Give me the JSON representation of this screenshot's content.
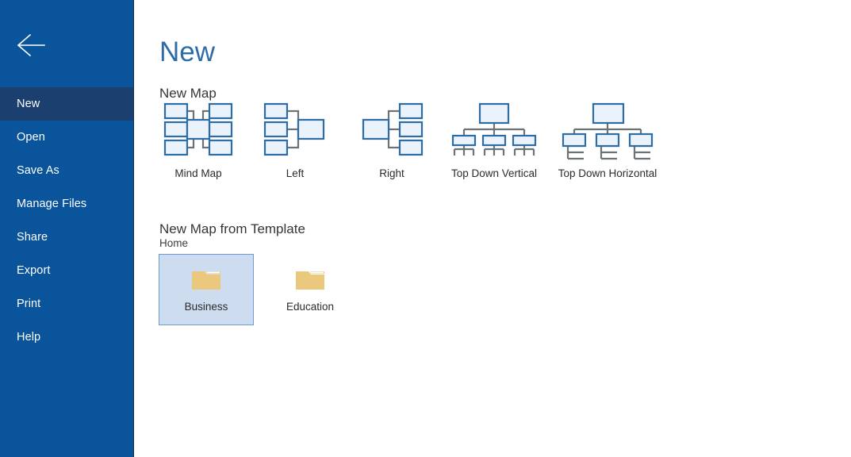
{
  "window": {
    "title": "New"
  },
  "sidebar": {
    "back_icon": "back-arrow-icon",
    "background_color": "#0a549b",
    "active_color": "#1b3f6e",
    "items": [
      {
        "label": "New",
        "active": true
      },
      {
        "label": "Open",
        "active": false
      },
      {
        "label": "Save As",
        "active": false
      },
      {
        "label": "Manage Files",
        "active": false
      },
      {
        "label": "Share",
        "active": false
      },
      {
        "label": "Export",
        "active": false
      },
      {
        "label": "Print",
        "active": false
      },
      {
        "label": "Help",
        "active": false
      }
    ]
  },
  "main": {
    "page_title": "New",
    "title_color": "#2e6ca8",
    "new_map": {
      "heading": "New Map",
      "node_fill": "#eaf3fb",
      "node_stroke": "#2e6da4",
      "connector_color": "#6b7377",
      "items": [
        {
          "label": "Mind Map",
          "icon": "mind-map-icon"
        },
        {
          "label": "Left",
          "icon": "left-layout-icon"
        },
        {
          "label": "Right",
          "icon": "right-layout-icon"
        },
        {
          "label": "Top Down Vertical",
          "icon": "top-down-vertical-icon"
        },
        {
          "label": "Top Down Horizontal",
          "icon": "top-down-horizontal-icon"
        }
      ]
    },
    "template": {
      "heading": "New Map from Template",
      "breadcrumb": "Home",
      "folder_color": "#eac97e",
      "selection_fill": "#cddcef",
      "selection_border": "#6f9ad0",
      "tiles": [
        {
          "label": "Business",
          "icon": "folder-icon",
          "selected": true
        },
        {
          "label": "Education",
          "icon": "folder-icon",
          "selected": false
        }
      ]
    }
  }
}
